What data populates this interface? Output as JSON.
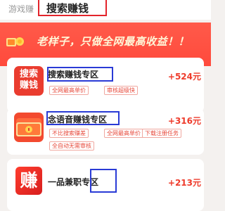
{
  "tabs": {
    "inactive": "游戏赚",
    "active": "搜索赚钱"
  },
  "banner": {
    "text": "老样子，只做全网最高收益！！"
  },
  "items": [
    {
      "icon_text": "搜索\n赚钱",
      "title": "搜索赚钱专区",
      "price": "+524元",
      "tags": [
        "全网最高单价",
        "审核超级快"
      ]
    },
    {
      "title": "念语音赚钱专区",
      "price": "+316元",
      "tags": [
        "不比搜索赚差",
        "全网最高单价",
        "下载注册任务",
        "全自动无需审核"
      ]
    },
    {
      "icon_text": "赚",
      "title": "一品兼职专区",
      "price": "+213元"
    }
  ],
  "colors": {
    "accent_red": "#ee3b2b",
    "banner_red": "#ff4a3c",
    "highlight_blue": "#2a3bd6"
  }
}
